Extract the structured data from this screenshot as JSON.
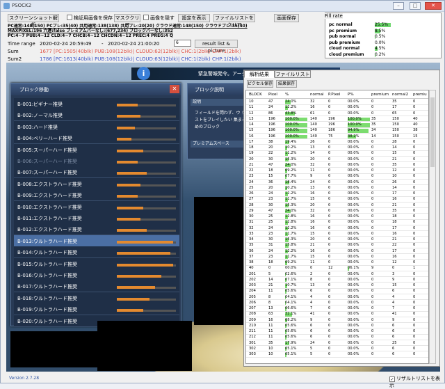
{
  "window": {
    "title": "PSOCK2"
  },
  "toolbar": {
    "screenshot_label": "スクリーンショット解析",
    "save_verified_label": "検証用画像を保存",
    "mask_clear_label": "マスククリア",
    "hide_image_label": "画像を隠す",
    "show_settings_label": "設定を表示",
    "clear_filelist_label": "ファイルリストをクリア",
    "save_image_label": "画面保存"
  },
  "info_lines": [
    "PC通常:148(150) PCプレ:35(40) 共用通常:138(138) 共用プレ:20(20) クラウド通常:148(150) クラウドプレ:35(40)",
    "MAXPIXEL:196 六連:false プレミアムバーなし:(677,234) ブロックバーなし:352",
    "PC:4~7 PUB:4~12 CLD:4~7 CHCB:4~12 CHCDN:4~12 PREC:4 PREG:4 Q"
  ],
  "time_range": {
    "label": "Time range",
    "start": "2020-02-24 20:59:49",
    "sep": "-",
    "end": "2020-02-24 21:00:20",
    "count": "6",
    "result_button": "result list & picture"
  },
  "sum": {
    "label": "Sum",
    "value": "1677 [PC:1505(40blk) PUB:108(12blk)| CLOUD:62(12blk)| CHC:1(2blk) CHP:1(2blk)",
    "color": "#e0564a"
  },
  "sum2": {
    "label": "Sum2",
    "value": "1786 [PC:1613(40blk) PUB:108(12blk)| CLOUD:63(12blk)| CHC:1(2blk) CHP:1(2blk)",
    "color": "#3a55c8"
  },
  "fill_rate": {
    "title": "Fill rate",
    "rows": [
      {
        "name": "pc normal",
        "value": "25.5%",
        "pct": 25.5
      },
      {
        "name": "pc premium",
        "value": "8.5%",
        "pct": 8.5
      },
      {
        "name": "pub normal",
        "value": "0.5%",
        "pct": 0.5
      },
      {
        "name": "pub premium",
        "value": "0.0%",
        "pct": 0
      },
      {
        "name": "cloud normal",
        "value": "4.5%",
        "pct": 4.5
      },
      {
        "name": "cloud premium",
        "value": "0.2%",
        "pct": 0.2
      }
    ]
  },
  "game": {
    "marquee": "緊急警報発令。アーク"
  },
  "block_window": {
    "title": "ブロック移動",
    "items": [
      {
        "label": "B-001:ビギナー推奨",
        "fill": 0.35
      },
      {
        "label": "B-002:ノーマル推奨",
        "fill": 0.4
      },
      {
        "label": "B-003:ハード推奨",
        "fill": 0.3
      },
      {
        "label": "B-004:ベリーハード推奨",
        "fill": 0.25
      },
      {
        "label": "B-005:スーパーハード推奨",
        "fill": 0.45
      },
      {
        "label": "B-006:スーパーハード推奨",
        "fill": 0.35,
        "dim": true
      },
      {
        "label": "B-007:スーパーハード推奨",
        "fill": 0.5
      },
      {
        "label": "B-008:エクストラハード推奨",
        "fill": 0.4
      },
      {
        "label": "B-009:エクストラハード推奨",
        "fill": 0.35
      },
      {
        "label": "B-010:エクストラハード推奨",
        "fill": 0.45
      },
      {
        "label": "B-011:エクストラハード推奨",
        "fill": 0.4
      },
      {
        "label": "B-012:エクストラハード推奨",
        "fill": 0.5
      },
      {
        "label": "B-013:ウルトラハード推奨",
        "fill": 0.95,
        "selected": true
      },
      {
        "label": "B-014:ウルトラハード推奨",
        "fill": 0.9
      },
      {
        "label": "B-015:ウルトラハード推奨",
        "fill": 0.95
      },
      {
        "label": "B-016:ウルトラハード推奨",
        "fill": 0.75
      },
      {
        "label": "B-017:ウルトラハード推奨",
        "fill": 0.65
      },
      {
        "label": "B-018:ウルトラハード推奨",
        "fill": 0.55
      },
      {
        "label": "B-019:ウルトラハード推奨",
        "fill": 0.45
      },
      {
        "label": "B-020:ウルトラハード推奨",
        "fill": 0.4
      }
    ]
  },
  "explain_window": {
    "title": "ブロック説明",
    "sub": "説明",
    "text": "フィールドを問わず、ウ クエストをプレイしたい 集まるためのブロック",
    "premium": "プレミアムスペース"
  },
  "tabs": [
    "解析結果",
    "ファイルリスト"
  ],
  "panel_buttons": {
    "pixel_save": "ピクセル保存",
    "result_save": "結果保存"
  },
  "grid": {
    "columns": [
      "BLOCK",
      "Pixel",
      "%",
      "normal",
      "P.Pixel",
      "P%",
      "premium",
      "normal2",
      "premiu"
    ],
    "rows": [
      [
        "10",
        "47",
        "24.0%",
        "32",
        "0",
        "00.0%",
        "0",
        "35",
        "0"
      ],
      [
        "11",
        "24",
        "12.2%",
        "16",
        "0",
        "00.0%",
        "0",
        "17",
        "0"
      ],
      [
        "12",
        "86",
        "43.8%",
        "61",
        "0",
        "00.0%",
        "0",
        "65",
        "0"
      ],
      [
        "13",
        "196",
        "100.0%",
        "140",
        "196",
        "100.0%",
        "35",
        "150",
        "40"
      ],
      [
        "14",
        "196",
        "100.0%",
        "140",
        "196",
        "100.0%",
        "35",
        "150",
        "40"
      ],
      [
        "15",
        "196",
        "100.0%",
        "140",
        "186",
        "94.9%",
        "34",
        "150",
        "38"
      ],
      [
        "16",
        "196",
        "100.0%",
        "140",
        "75",
        "38.2%",
        "14",
        "150",
        "15"
      ],
      [
        "17",
        "38",
        "19.4%",
        "26",
        "0",
        "00.0%",
        "0",
        "28",
        "0"
      ],
      [
        "18",
        "20",
        "10.2%",
        "13",
        "0",
        "00.0%",
        "0",
        "14",
        "0"
      ],
      [
        "19",
        "22",
        "11.2%",
        "14",
        "0",
        "00.0%",
        "0",
        "15",
        "0"
      ],
      [
        "20",
        "30",
        "15.3%",
        "20",
        "0",
        "00.0%",
        "0",
        "21",
        "0"
      ],
      [
        "21",
        "47",
        "24.0%",
        "32",
        "0",
        "00.0%",
        "0",
        "35",
        "0"
      ],
      [
        "22",
        "18",
        "09.2%",
        "11",
        "0",
        "00.0%",
        "0",
        "12",
        "0"
      ],
      [
        "23",
        "15",
        "07.7%",
        "9",
        "0",
        "00.0%",
        "0",
        "10",
        "0"
      ],
      [
        "24",
        "36",
        "18.4%",
        "24",
        "0",
        "00.0%",
        "0",
        "26",
        "0"
      ],
      [
        "25",
        "20",
        "10.2%",
        "13",
        "0",
        "00.0%",
        "0",
        "14",
        "0"
      ],
      [
        "26",
        "24",
        "12.2%",
        "16",
        "0",
        "00.0%",
        "0",
        "17",
        "0"
      ],
      [
        "27",
        "23",
        "11.7%",
        "15",
        "0",
        "00.0%",
        "0",
        "16",
        "0"
      ],
      [
        "28",
        "30",
        "15.3%",
        "20",
        "0",
        "00.0%",
        "0",
        "21",
        "0"
      ],
      [
        "29",
        "47",
        "24.0%",
        "32",
        "0",
        "00.0%",
        "0",
        "35",
        "0"
      ],
      [
        "30",
        "25",
        "12.8%",
        "16",
        "0",
        "00.0%",
        "0",
        "18",
        "0"
      ],
      [
        "31",
        "25",
        "12.8%",
        "16",
        "0",
        "00.0%",
        "0",
        "18",
        "0"
      ],
      [
        "32",
        "24",
        "12.2%",
        "16",
        "0",
        "00.0%",
        "0",
        "17",
        "0"
      ],
      [
        "33",
        "23",
        "11.7%",
        "15",
        "0",
        "00.0%",
        "0",
        "16",
        "0"
      ],
      [
        "34",
        "30",
        "15.3%",
        "20",
        "0",
        "00.0%",
        "0",
        "21",
        "0"
      ],
      [
        "35",
        "31",
        "15.8%",
        "21",
        "0",
        "00.0%",
        "0",
        "22",
        "0"
      ],
      [
        "36",
        "24",
        "12.2%",
        "16",
        "0",
        "00.0%",
        "0",
        "17",
        "0"
      ],
      [
        "37",
        "23",
        "11.7%",
        "15",
        "0",
        "00.0%",
        "0",
        "16",
        "0"
      ],
      [
        "38",
        "18",
        "09.2%",
        "11",
        "0",
        "00.0%",
        "0",
        "12",
        "0"
      ],
      [
        "40",
        "0",
        "00.0%",
        "0",
        "12",
        "06.1%",
        "9",
        "0",
        "1"
      ],
      [
        "201",
        "5",
        "02.6%",
        "2",
        "0",
        "00.0%",
        "0",
        "3",
        "0"
      ],
      [
        "202",
        "14",
        "07.1%",
        "8",
        "0",
        "00.0%",
        "0",
        "9",
        "0"
      ],
      [
        "203",
        "21",
        "10.7%",
        "13",
        "0",
        "00.0%",
        "0",
        "15",
        "0"
      ],
      [
        "204",
        "11",
        "05.6%",
        "6",
        "0",
        "00.0%",
        "0",
        "6",
        "0"
      ],
      [
        "205",
        "8",
        "04.1%",
        "4",
        "0",
        "00.0%",
        "0",
        "4",
        "0"
      ],
      [
        "206",
        "8",
        "04.1%",
        "4",
        "0",
        "00.0%",
        "0",
        "4",
        "0"
      ],
      [
        "207",
        "13",
        "06.6%",
        "7",
        "0",
        "00.0%",
        "0",
        "7",
        "0"
      ],
      [
        "208",
        "63",
        "32.1%",
        "41",
        "0",
        "00.0%",
        "0",
        "41",
        "0"
      ],
      [
        "209",
        "16",
        "08.2%",
        "9",
        "0",
        "00.0%",
        "0",
        "9",
        "0"
      ],
      [
        "210",
        "11",
        "05.6%",
        "6",
        "0",
        "00.0%",
        "0",
        "6",
        "0"
      ],
      [
        "211",
        "11",
        "05.6%",
        "6",
        "0",
        "00.0%",
        "0",
        "6",
        "0"
      ],
      [
        "212",
        "11",
        "05.6%",
        "6",
        "0",
        "00.0%",
        "0",
        "6",
        "0"
      ],
      [
        "301",
        "35",
        "17.9%",
        "24",
        "0",
        "00.0%",
        "0",
        "25",
        "0"
      ],
      [
        "302",
        "10",
        "05.1%",
        "5",
        "0",
        "00.0%",
        "0",
        "6",
        "0"
      ],
      [
        "303",
        "10",
        "05.1%",
        "5",
        "0",
        "00.0%",
        "0",
        "6",
        "0"
      ]
    ]
  },
  "footer": {
    "version": "Version 2.7.28",
    "result_list_checkbox": "リザルトリストを表示",
    "result_list_checked": true
  }
}
